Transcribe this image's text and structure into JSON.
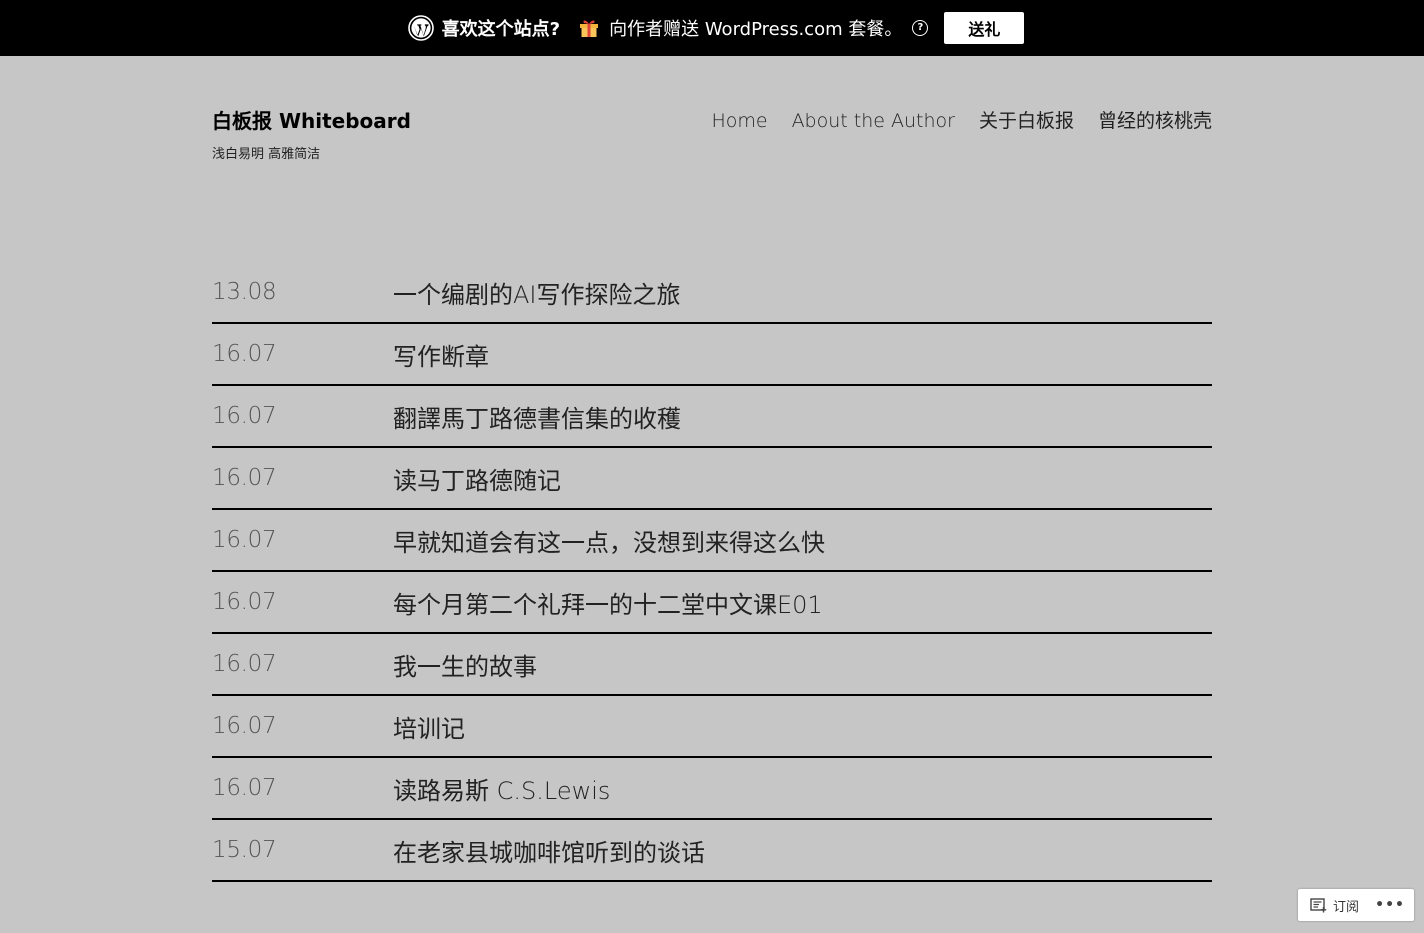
{
  "promo_bar": {
    "logo_icon": "wordpress-logo-icon",
    "question": "喜欢这个站点?",
    "gift_icon": "gift-icon",
    "text": "向作者赠送 WordPress.com 套餐。",
    "help_icon": "help-circle-icon",
    "help_glyph": "?",
    "button_label": "送礼",
    "background_color": "#000000"
  },
  "site": {
    "title": "白板报 Whiteboard",
    "tagline": "浅白易明 高雅简洁",
    "background_color": "#c6c6c6"
  },
  "nav": {
    "items": [
      {
        "label": "Home"
      },
      {
        "label": "About the Author"
      },
      {
        "label": "关于白板报"
      },
      {
        "label": "曾经的核桃壳"
      }
    ]
  },
  "posts": [
    {
      "date": "13.08",
      "title": "一个编剧的AI写作探险之旅"
    },
    {
      "date": "16.07",
      "title": "写作断章"
    },
    {
      "date": "16.07",
      "title": "翻譯馬丁路德書信集的收穫"
    },
    {
      "date": "16.07",
      "title": "读马丁路德随记"
    },
    {
      "date": "16.07",
      "title": "早就知道会有这一点，没想到来得这么快"
    },
    {
      "date": "16.07",
      "title": "每个月第二个礼拜一的十二堂中文课E01"
    },
    {
      "date": "16.07",
      "title": "我一生的故事"
    },
    {
      "date": "16.07",
      "title": "培训记"
    },
    {
      "date": "16.07",
      "title": "读路易斯 C.S.Lewis"
    },
    {
      "date": "15.07",
      "title": "在老家县城咖啡馆听到的谈话"
    }
  ],
  "follow_widget": {
    "reader_icon": "reader-subscribe-icon",
    "label": "订阅",
    "more_icon": "more-ellipsis-icon",
    "more_glyph": "•••"
  }
}
